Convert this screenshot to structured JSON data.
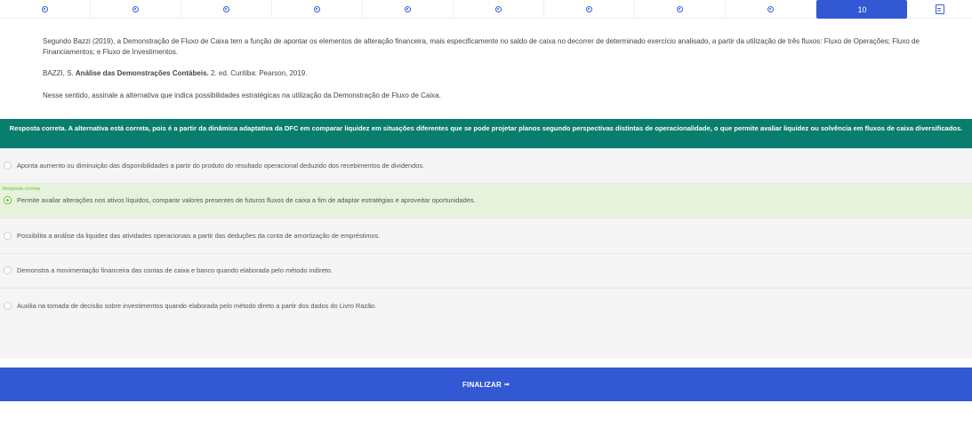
{
  "nav": {
    "active_question": "10"
  },
  "question": {
    "paragraph1": "Segundo Bazzi (2019), a Demonstração de Fluxo de Caixa tem a função de apontar os elementos de alteração financeira, mais especificamente no saldo de caixa no decorrer de determinado exercício analisado, a partir da utilização de três fluxos: Fluxo de Operações; Fluxo de Financiamentos; e Fluxo de Investimentos.",
    "reference_author": "BAZZI, S.",
    "reference_title": "Análise das Demonstrações Contábeis.",
    "reference_rest": "2. ed. Curitiba: Pearson, 2019.",
    "prompt": "Nesse sentido, assinale a alternativa que indica possibilidades estratégicas na utilização da Demonstração de Fluxo de Caixa."
  },
  "feedback": {
    "text": "Resposta correta. A alternativa está correta, pois é a partir da dinâmica adaptativa da DFC em comparar liquidez em situações diferentes que se pode projetar planos segundo perspectivas distintas de operacionalidade, o que permite avaliar liquidez ou solvência em fluxos de caixa diversificados."
  },
  "alternatives": [
    {
      "text": "Aponta aumento ou diminuição das disponibilidades a partir do produto do resultado operacional deduzido dos recebimentos de dividendos."
    },
    {
      "text": "Permite avaliar alterações nos ativos líquidos, comparar valores presentes de futuros fluxos de caixa a fim de adaptar estratégias e aproveitar oportunidades.",
      "tag": "Resposta correta"
    },
    {
      "text": "Possibilita a análise da liquidez das atividades operacionais a partir das deduções da conta de amortização de empréstimos."
    },
    {
      "text": "Demonstra a movimentação financeira das contas de caixa e banco quando elaborada pelo método indireto."
    },
    {
      "text": "Auxilia na tomada de decisão sobre investimentos quando elaborada pelo método direto a partir dos dados do Livro Razão."
    }
  ],
  "finalizar": {
    "label": "FINALIZAR",
    "arrow": "⇒"
  },
  "colors": {
    "primary": "#3358d4",
    "feedback_bg": "#0a7e6e",
    "correct_bg": "#e6f2dc",
    "correct_accent": "#6cbf2c"
  }
}
